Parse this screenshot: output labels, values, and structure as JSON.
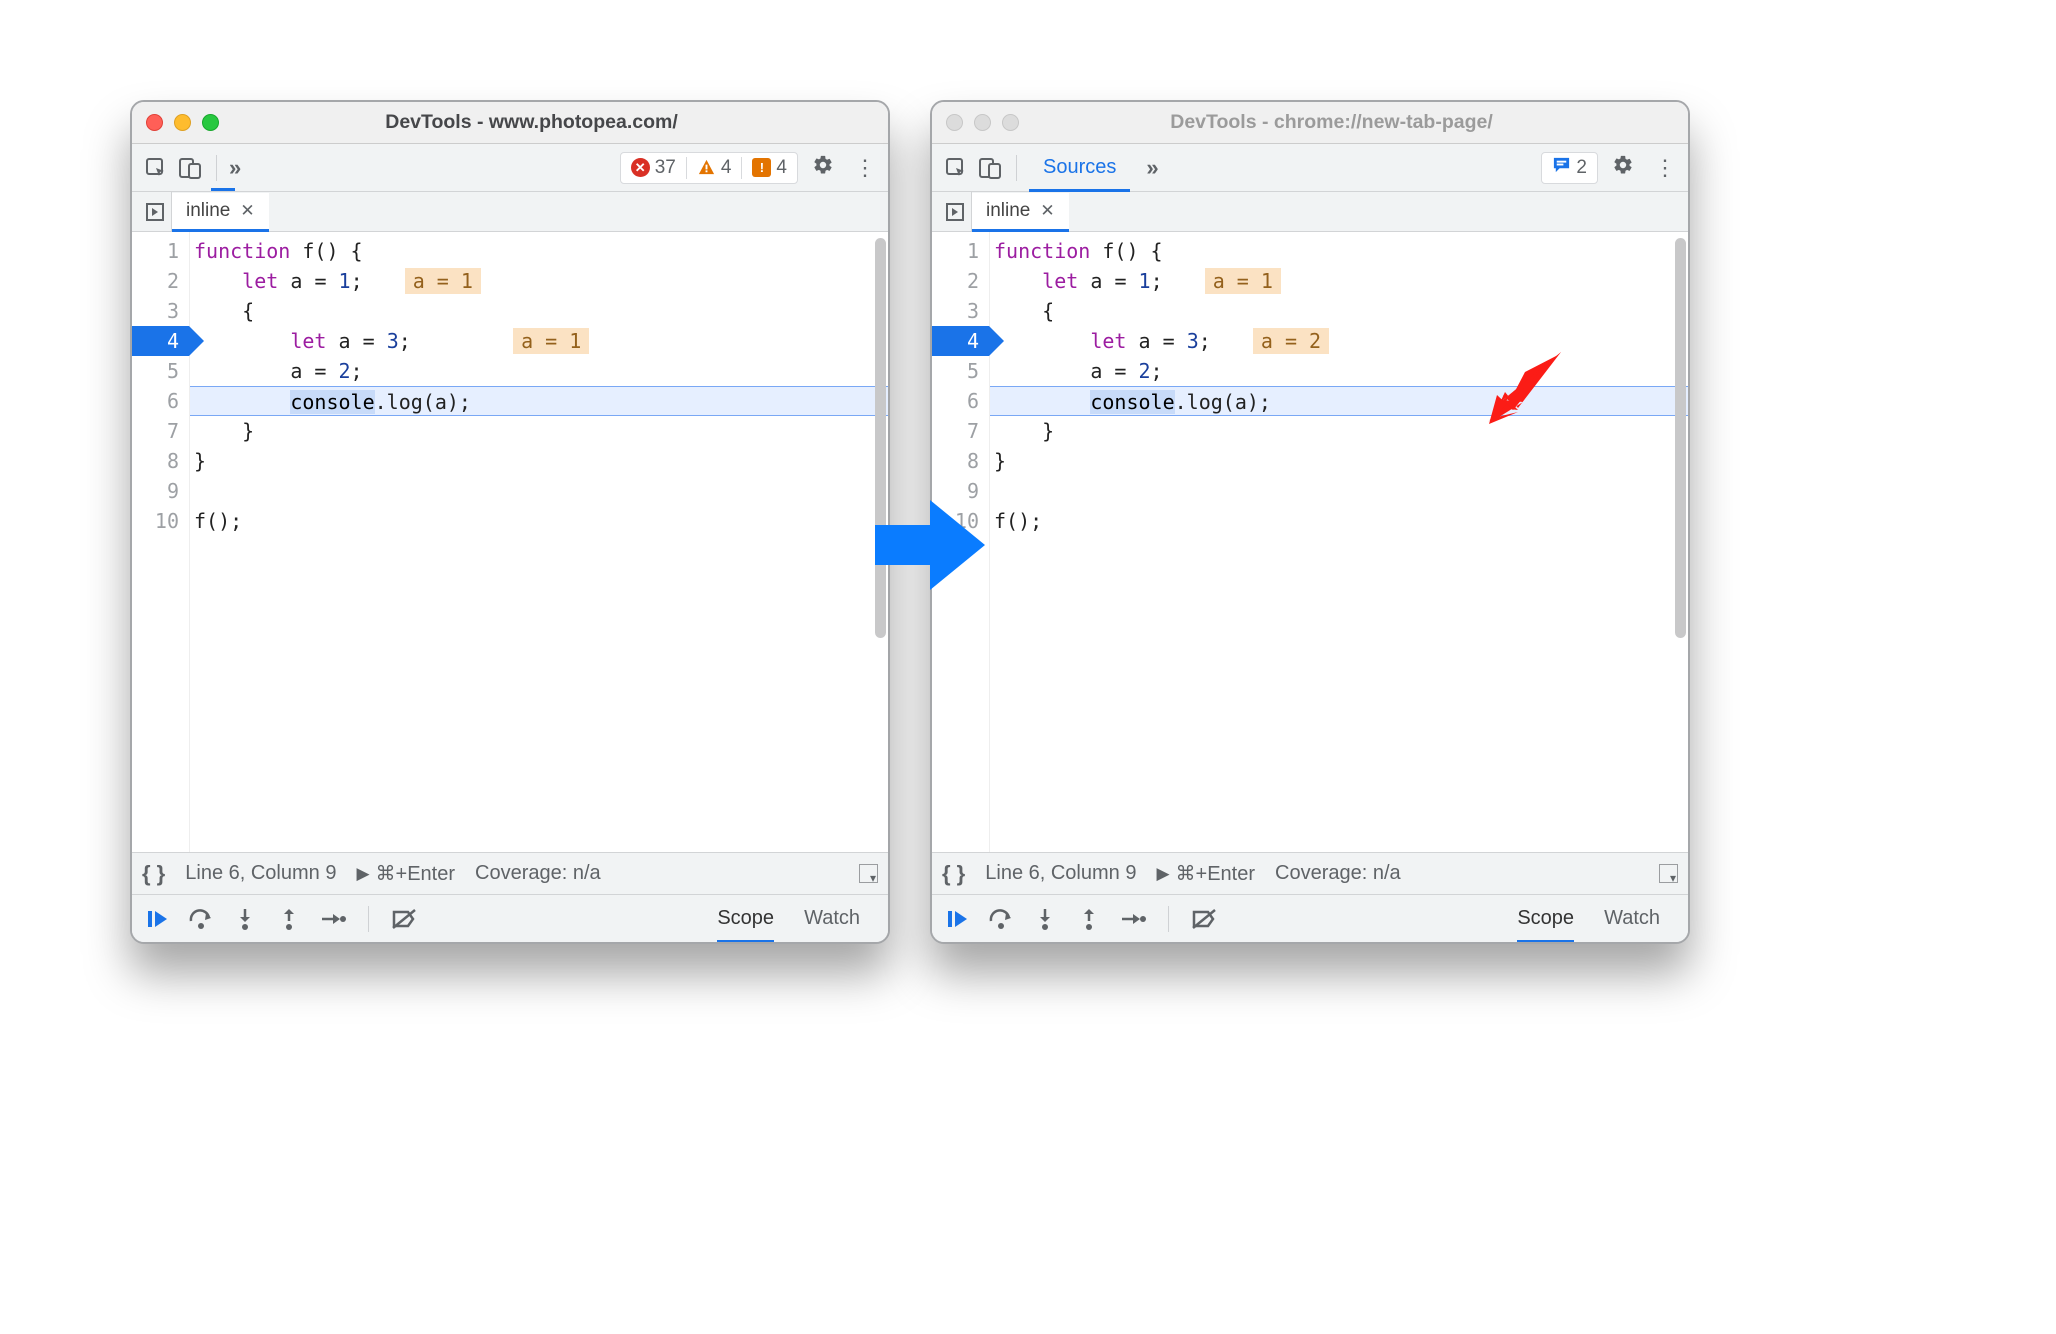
{
  "left": {
    "title": "DevTools - www.photopea.com/",
    "badges": {
      "errors": "37",
      "warnings": "4",
      "issues": "4"
    },
    "tab": "inline",
    "status": {
      "pos": "Line 6, Column 9",
      "run": "⌘+Enter",
      "cov": "Coverage: n/a"
    },
    "dbg": {
      "scope": "Scope",
      "watch": "Watch"
    },
    "lines": {
      "l1": "function f() {",
      "l2": "    let a = 1;",
      "l3": "    {",
      "l4": "        let a = 3;",
      "l5": "        a = 2;",
      "l6": "        console.log(a);",
      "l7": "    }",
      "l8": "}",
      "l9": "",
      "l10": "f();"
    },
    "inline_vals": {
      "line2": "a = 1",
      "line4": "a = 1"
    }
  },
  "right": {
    "title": "DevTools - chrome://new-tab-page/",
    "badges": {
      "messages": "2"
    },
    "toolbar_tab": "Sources",
    "tab": "inline",
    "status": {
      "pos": "Line 6, Column 9",
      "run": "⌘+Enter",
      "cov": "Coverage: n/a"
    },
    "dbg": {
      "scope": "Scope",
      "watch": "Watch"
    },
    "lines": {
      "l1": "function f() {",
      "l2": "    let a = 1;",
      "l3": "    {",
      "l4": "        let a = 3;",
      "l5": "        a = 2;",
      "l6": "        console.log(a);",
      "l7": "    }",
      "l8": "}",
      "l9": "",
      "l10": "f();"
    },
    "inline_vals": {
      "line2": "a = 1",
      "line4": "a = 2"
    }
  }
}
